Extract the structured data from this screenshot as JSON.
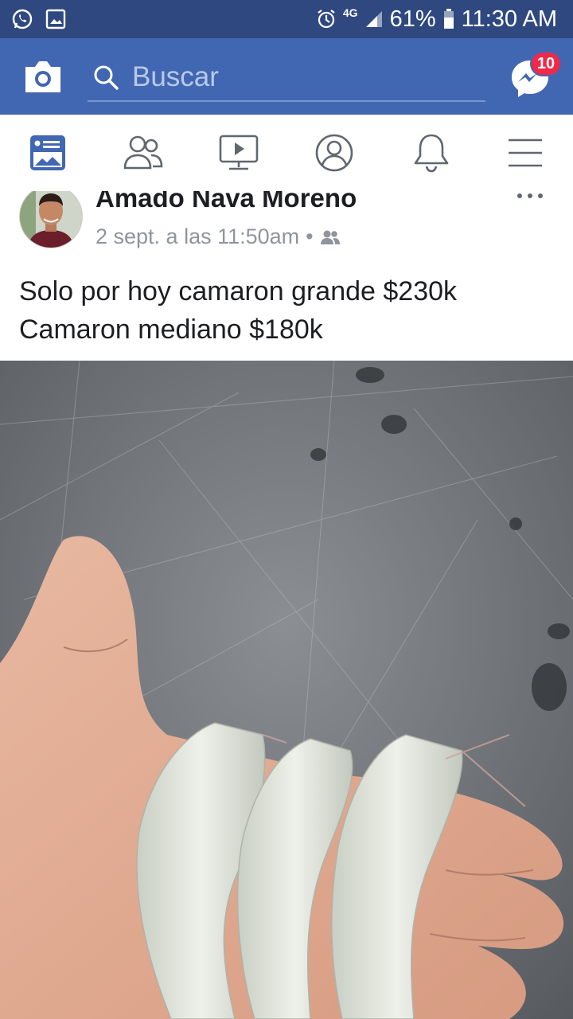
{
  "status_bar": {
    "network": "4G",
    "battery": "61%",
    "time": "11:30 AM",
    "icons": [
      "whatsapp-icon",
      "gallery-icon",
      "alarm-icon",
      "signal-icon",
      "battery-icon"
    ]
  },
  "header": {
    "search_placeholder": "Buscar",
    "messenger_badge": "10",
    "colors": {
      "bar": "#4267b2",
      "status": "#2f4880",
      "badge": "#f02849"
    }
  },
  "tabs": [
    {
      "name": "news-feed",
      "icon": "news-feed-icon",
      "active": true
    },
    {
      "name": "friends",
      "icon": "friends-icon"
    },
    {
      "name": "watch",
      "icon": "watch-icon"
    },
    {
      "name": "profile",
      "icon": "profile-icon"
    },
    {
      "name": "notifications",
      "icon": "bell-icon"
    },
    {
      "name": "menu",
      "icon": "hamburger-menu-icon"
    }
  ],
  "post": {
    "author": "Amado Nava Moreno",
    "timestamp": "2 sept. a las 11:50am",
    "separator": "•",
    "privacy_icon": "friends-audience-icon",
    "text_lines": [
      "Solo por hoy camaron grande $230k",
      "Camaron mediano $180k"
    ]
  }
}
